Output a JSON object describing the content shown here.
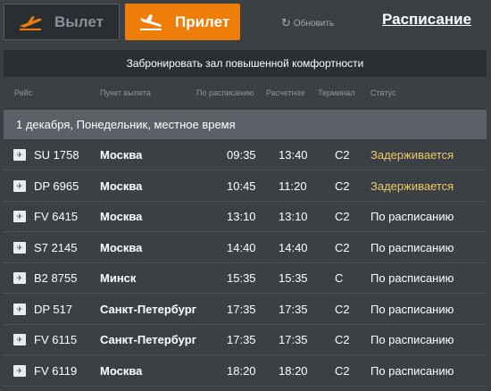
{
  "tabs": {
    "departure_label": "Вылет",
    "arrival_label": "Прилет"
  },
  "refresh_label": "Обновить",
  "schedule_link": "Расписание",
  "book_lounge": "Забронировать зал повышенной комфортности",
  "columns": [
    "Рейс",
    "Пункт вылета",
    "По расписанию",
    "Расчетное",
    "Терминал",
    "Статус"
  ],
  "date_header": "1 декабря, Понедельник, местное время",
  "colors": {
    "accent": "#ef7d0a",
    "delayed": "#f0c96a",
    "background": "#3b4045"
  },
  "flights": [
    {
      "logo": "airline-logo-icon",
      "flight": "SU 1758",
      "city": "Москва",
      "scheduled": "09:35",
      "estimated": "13:40",
      "terminal": "C2",
      "status": "Задерживается",
      "delayed": true
    },
    {
      "logo": "airline-logo-icon",
      "flight": "DP 6965",
      "city": "Москва",
      "scheduled": "10:45",
      "estimated": "11:20",
      "terminal": "C2",
      "status": "Задерживается",
      "delayed": true
    },
    {
      "logo": "airline-logo-icon",
      "flight": "FV 6415",
      "city": "Москва",
      "scheduled": "13:10",
      "estimated": "13:10",
      "terminal": "C2",
      "status": "По расписанию",
      "delayed": false
    },
    {
      "logo": "airline-logo-icon",
      "flight": "S7 2145",
      "city": "Москва",
      "scheduled": "14:40",
      "estimated": "14:40",
      "terminal": "C2",
      "status": "По расписанию",
      "delayed": false
    },
    {
      "logo": "airline-logo-icon",
      "flight": "B2 8755",
      "city": "Минск",
      "scheduled": "15:35",
      "estimated": "15:35",
      "terminal": "C",
      "status": "По расписанию",
      "delayed": false
    },
    {
      "logo": "airline-logo-icon",
      "flight": "DP 517",
      "city": "Санкт-Петербург",
      "scheduled": "17:35",
      "estimated": "17:35",
      "terminal": "C2",
      "status": "По расписанию",
      "delayed": false
    },
    {
      "logo": "airline-logo-icon",
      "flight": "FV 6115",
      "city": "Санкт-Петербург",
      "scheduled": "17:35",
      "estimated": "17:35",
      "terminal": "C2",
      "status": "По расписанию",
      "delayed": false
    },
    {
      "logo": "airline-logo-icon",
      "flight": "FV 6119",
      "city": "Москва",
      "scheduled": "18:20",
      "estimated": "18:20",
      "terminal": "C2",
      "status": "По расписанию",
      "delayed": false
    }
  ]
}
